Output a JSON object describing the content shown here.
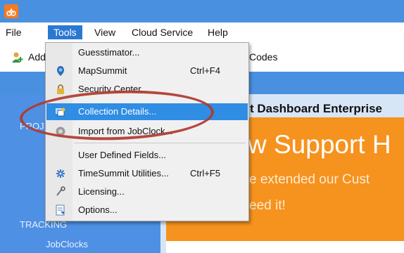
{
  "menubar": {
    "items": [
      {
        "label": "File"
      },
      {
        "label": "Tools"
      },
      {
        "label": "View"
      },
      {
        "label": "Cloud Service"
      },
      {
        "label": "Help"
      }
    ]
  },
  "toolbar": {
    "add_label": "Add",
    "codes_label": "Codes"
  },
  "sidebar": {
    "section1": "PROJ",
    "section2": "TRACKING",
    "item1": "JobClocks"
  },
  "main": {
    "dashboard_title": "t Dashboard Enterprise",
    "banner_heading": "w Support H",
    "banner_line1": "e extended our Cust",
    "banner_line2": "eed it!"
  },
  "tools_menu": {
    "items": [
      {
        "label": "Guesstimator...",
        "shortcut": "",
        "icon": "none"
      },
      {
        "label": "MapSummit",
        "shortcut": "Ctrl+F4",
        "icon": "map-pin-icon"
      },
      {
        "label": "Security Center...",
        "shortcut": "",
        "icon": "lock-icon"
      },
      {
        "label": "Collection Details...",
        "shortcut": "",
        "icon": "collection-icon"
      },
      {
        "label": "Import from JobClock...",
        "shortcut": "",
        "icon": "import-icon"
      },
      {
        "label": "User Defined Fields...",
        "shortcut": "",
        "icon": "none"
      },
      {
        "label": "TimeSummit Utilities...",
        "shortcut": "Ctrl+F5",
        "icon": "utilities-icon"
      },
      {
        "label": "Licensing...",
        "shortcut": "",
        "icon": "license-icon"
      },
      {
        "label": "Options...",
        "shortcut": "",
        "icon": "options-icon"
      }
    ],
    "highlighted_index": 3
  },
  "colors": {
    "accent": "#2b78d3",
    "sidebar": "#4e90e3",
    "banner": "#f6921e",
    "annotation": "#b03a2e"
  }
}
